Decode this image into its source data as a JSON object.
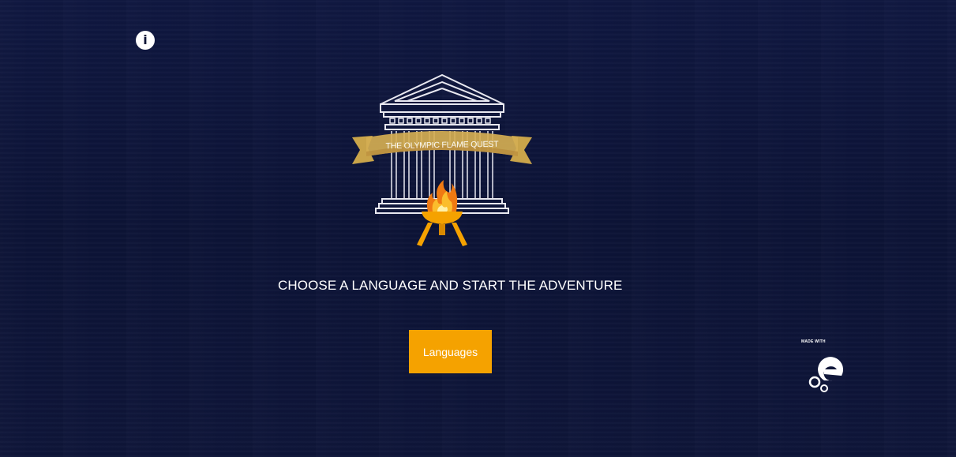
{
  "info": {
    "icon": "info-icon",
    "glyph": "i"
  },
  "logo": {
    "icon": "temple-flame-logo",
    "banner_text": "THE OLYMPIC FLAME QUEST"
  },
  "tagline": "CHOOSE A LANGUAGE AND START THE ADVENTURE",
  "languages_button": {
    "label": "Languages"
  },
  "made_with": {
    "label": "MADE WITH",
    "icon": "genially-logo-icon"
  },
  "colors": {
    "background": "#0d1437",
    "accent": "#f5a200",
    "banner": "#c9a44a",
    "text": "#ffffff"
  }
}
